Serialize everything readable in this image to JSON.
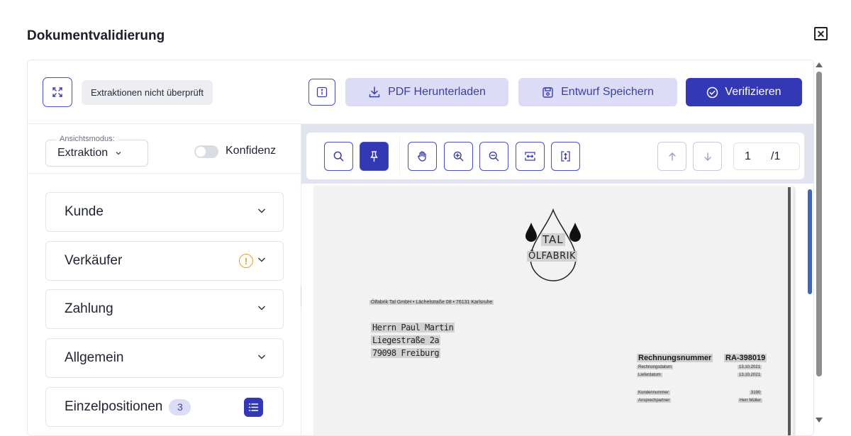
{
  "dialog": {
    "title": "Dokumentvalidierung",
    "close_label": "✕"
  },
  "toolbar": {
    "status_chip": "Extraktionen nicht überprüft",
    "download_label": "PDF Herunterladen",
    "save_draft_label": "Entwurf Speichern",
    "verify_label": "Verifizieren"
  },
  "left_panel": {
    "view_mode_legend": "Ansichtsmodus:",
    "view_mode_value": "Extraktion",
    "confidence_label": "Konfidenz",
    "sections": [
      {
        "label": "Kunde"
      },
      {
        "label": "Verkäufer",
        "warning": "!"
      },
      {
        "label": "Zahlung"
      },
      {
        "label": "Allgemein"
      },
      {
        "label": "Einzelpositionen",
        "count": "3"
      }
    ]
  },
  "viewer": {
    "current_page": "1",
    "total_pages": "/1"
  },
  "document": {
    "logo_line1": "TAL",
    "logo_line2": "ÖLFABRIK",
    "sender_line": "Ölfabrik Tal GmbH • Lächelstraße 08 • 76131 Karlsruhe",
    "recipient_name": "Herrn Paul Martin",
    "recipient_street": "Liegestraße 2a",
    "recipient_city": "79098 Freiburg",
    "invoice_number_label": "Rechnungsnummer",
    "invoice_number_value": "RA-398019",
    "invoice_date_label": "Rechnungsdatum",
    "invoice_date_value": "13.10.2021",
    "delivery_date_label": "Lieferdatum",
    "delivery_date_value": "13.10.2021",
    "customer_number_label": "Kundennummer",
    "customer_number_value": "3190",
    "contact_label": "Ansprechpartner",
    "contact_value": "Herr Müller"
  }
}
